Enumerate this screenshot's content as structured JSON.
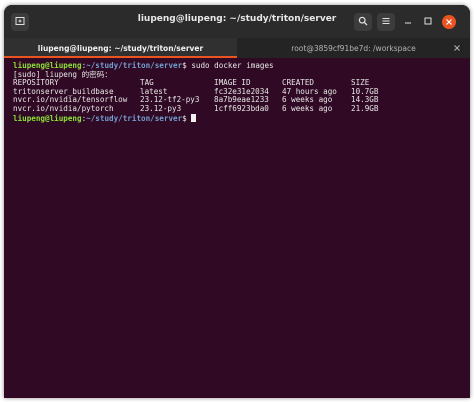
{
  "window": {
    "title": "liupeng@liupeng: ~/study/triton/server"
  },
  "tabs": [
    {
      "label": "liupeng@liupeng: ~/study/triton/server"
    },
    {
      "label": "root@3859cf91be7d: /workspace"
    }
  ],
  "icons": {
    "new_tab": "new-tab-icon",
    "search": "search-icon",
    "menu": "hamburger-menu-icon",
    "minimize": "minimize-icon",
    "maximize": "maximize-icon",
    "close": "close-icon"
  },
  "colors": {
    "terminal_bg": "#300a24",
    "prompt_user": "#8ae234",
    "prompt_path": "#729fcf",
    "accent": "#e95420"
  },
  "terminal": {
    "prompt_user": "liupeng@liupeng",
    "prompt_sep": ":",
    "prompt_path": "~/study/triton/server",
    "prompt_symbol": "$ ",
    "command": "sudo docker images",
    "sudo_prompt": "[sudo] liupeng 的密码：",
    "table": {
      "headers": [
        "REPOSITORY",
        "TAG",
        "IMAGE ID",
        "CREATED",
        "SIZE"
      ],
      "rows": [
        [
          "tritonserver_buildbase",
          "latest",
          "fc32e31e2034",
          "47 hours ago",
          "10.7GB"
        ],
        [
          "nvcr.io/nvidia/tensorflow",
          "23.12-tf2-py3",
          "8a7b9eae1233",
          "6 weeks ago",
          "14.3GB"
        ],
        [
          "nvcr.io/nvidia/pytorch",
          "23.12-py3",
          "1cff6923bda0",
          "6 weeks ago",
          "21.9GB"
        ]
      ]
    }
  }
}
